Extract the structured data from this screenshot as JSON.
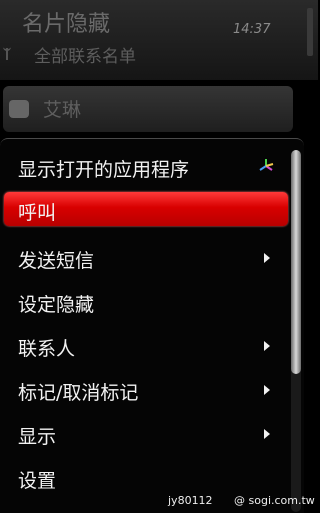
{
  "app": {
    "title": "名片隐藏",
    "subtitle": "全部联系名单",
    "clock": "14:37",
    "contact_name": "艾琳"
  },
  "menu": {
    "items": [
      {
        "label": "显示打开的应用程序",
        "submenu": false
      },
      {
        "label": "呼叫",
        "submenu": false,
        "selected": true
      },
      {
        "label": "发送短信",
        "submenu": true
      },
      {
        "label": "设定隐藏",
        "submenu": false
      },
      {
        "label": "联系人",
        "submenu": true
      },
      {
        "label": "标记/取消标记",
        "submenu": true
      },
      {
        "label": "显示",
        "submenu": true
      },
      {
        "label": "设置",
        "submenu": false
      }
    ],
    "scroll_position_fraction": 0.0,
    "scroll_visible_fraction": 0.62
  },
  "watermark": {
    "user": "jy80112",
    "site": "@ sogi.com.tw"
  },
  "colors": {
    "selection": "#d80000",
    "background": "#000000"
  },
  "icons": {
    "app_switch": "app-switch-icon",
    "submenu": "arrow-right-icon"
  }
}
